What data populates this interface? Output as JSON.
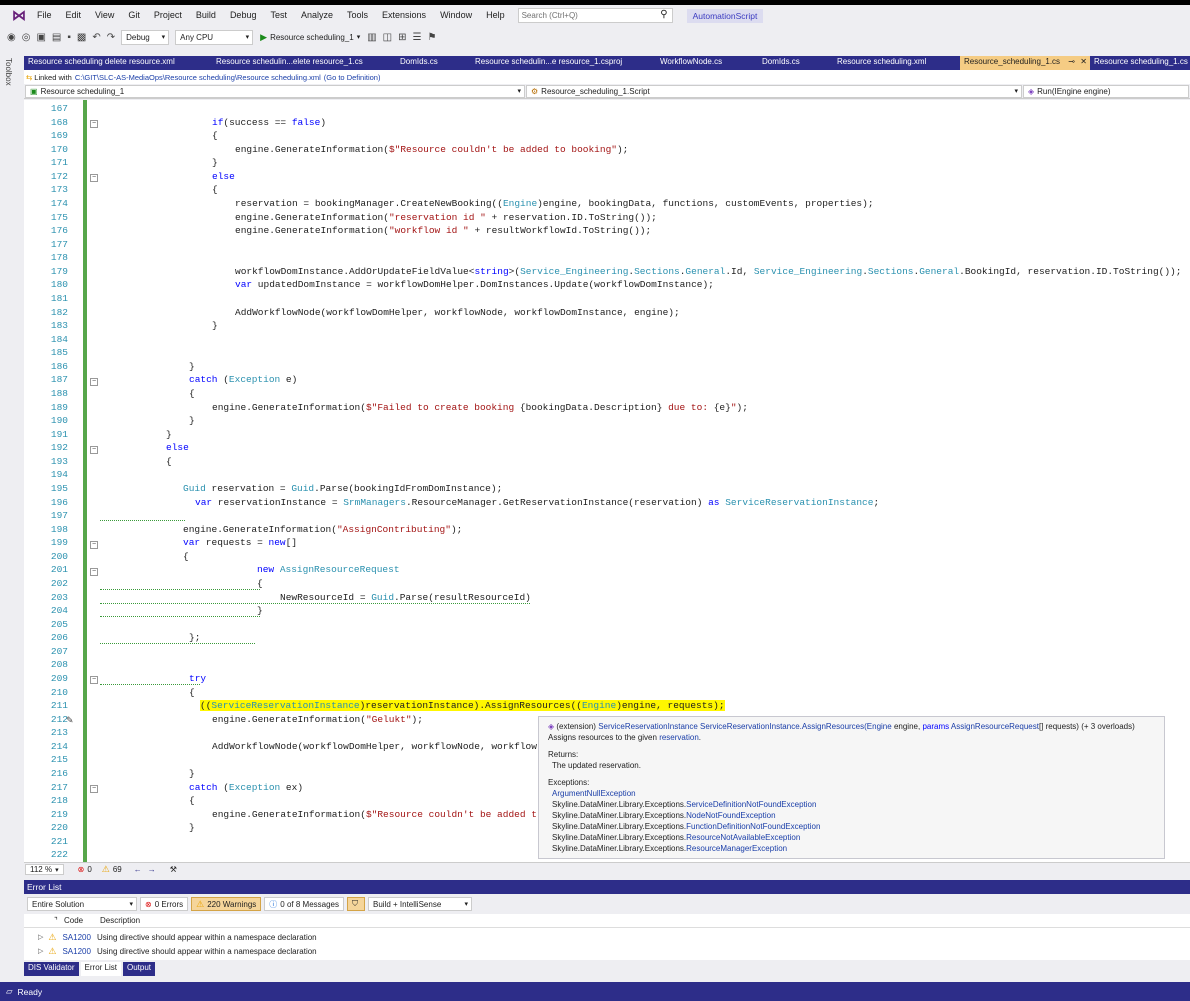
{
  "menu": [
    "File",
    "Edit",
    "View",
    "Git",
    "Project",
    "Build",
    "Debug",
    "Test",
    "Analyze",
    "Tools",
    "Extensions",
    "Window",
    "Help"
  ],
  "search": {
    "placeholder": "Search (Ctrl+Q)"
  },
  "automation_label": "AutomationScript",
  "toolbar": {
    "config": "Debug",
    "platform": "Any CPU",
    "run_target": "Resource scheduling_1"
  },
  "toolbox_label": "Toolbox",
  "tabs": [
    "Resource scheduling delete resource.xml",
    "Resource schedulin...elete resource_1.cs",
    "DomIds.cs",
    "Resource schedulin...e resource_1.csproj",
    "WorkflowNode.cs",
    "DomIds.cs",
    "Resource scheduling.xml",
    "Resource_scheduling_1.cs",
    "Resource scheduling_1.cs"
  ],
  "linked": {
    "prefix": "Linked with",
    "path": "C:\\GIT\\SLC-AS-MediaOps\\Resource scheduling\\Resource scheduling.xml",
    "goto": "(Go to Definition)"
  },
  "nav": {
    "project": "Resource scheduling_1",
    "class": "Resource_scheduling_1.Script",
    "member": "Run(IEngine engine)"
  },
  "line_numbers": [
    "167",
    "168",
    "169",
    "170",
    "171",
    "172",
    "173",
    "174",
    "175",
    "176",
    "177",
    "178",
    "179",
    "180",
    "181",
    "182",
    "183",
    "184",
    "185",
    "186",
    "187",
    "188",
    "189",
    "190",
    "191",
    "192",
    "193",
    "194",
    "195",
    "196",
    "197",
    "198",
    "199",
    "200",
    "201",
    "202",
    "203",
    "204",
    "205",
    "206",
    "207",
    "208",
    "209",
    "210",
    "211",
    "212",
    "213",
    "214",
    "215",
    "216",
    "217",
    "218",
    "219",
    "220",
    "221",
    "222"
  ],
  "code": {
    "l168": "if(success == false)",
    "l169": "{",
    "l170": "engine.GenerateInformation($\"Resource couldn't be added to booking\");",
    "l171": "}",
    "l172": "else",
    "l173": "{",
    "l174": "reservation = bookingManager.CreateNewBooking((Engine)engine, bookingData, functions, customEvents, properties);",
    "l175": "engine.GenerateInformation(\"reservation id \" + reservation.ID.ToString());",
    "l176": "engine.GenerateInformation(\"workflow id \" + resultWorkflowId.ToString());",
    "l179": "workflowDomInstance.AddOrUpdateFieldValue<string>(Service_Engineering.Sections.General.Id, Service_Engineering.Sections.General.BookingId, reservation.ID.ToString());",
    "l180": "var updatedDomInstance = workflowDomHelper.DomInstances.Update(workflowDomInstance);",
    "l182": "AddWorkflowNode(workflowDomHelper, workflowNode, workflowDomInstance, engine);",
    "l183": "}",
    "l186": "}",
    "l187": "catch (Exception e)",
    "l188": "{",
    "l189": "engine.GenerateInformation($\"Failed to create booking {bookingData.Description} due to: {e}\");",
    "l190": "}",
    "l191": "}",
    "l192": "else",
    "l193": "{",
    "l195": "Guid reservation = Guid.Parse(bookingIdFromDomInstance);",
    "l196": "var reservationInstance = SrmManagers.ResourceManager.GetReservationInstance(reservation) as ServiceReservationInstance;",
    "l198": "engine.GenerateInformation(\"AssignContributing\");",
    "l199": "var requests = new[]",
    "l200": "{",
    "l201": "new AssignResourceRequest",
    "l202": "{",
    "l203": "NewResourceId = Guid.Parse(resultResourceId)",
    "l204": "}",
    "l206": "};",
    "l209": "try",
    "l210": "{",
    "l211": "((ServiceReservationInstance)reservationInstance).AssignResources((Engine)engine, requests);",
    "l212": "engine.GenerateInformation(\"Gelukt\");",
    "l214": "AddWorkflowNode(workflowDomHelper, workflowNode, workflow",
    "l216": "}",
    "l217": "catch (Exception ex)",
    "l218": "{",
    "l219": "engine.GenerateInformation($\"Resource couldn't be added t",
    "l220": "}"
  },
  "tooltip": {
    "signature_prefix": "(extension)",
    "signature_type": "ServiceReservationInstance",
    "signature_method": "ServiceReservationInstance.AssignResources(",
    "signature_param1": "Engine",
    "signature_param1_name": "engine,",
    "signature_params_kw": "params",
    "signature_param2": "AssignResourceRequest",
    "signature_tail": "[] requests) (+ 3 overloads)",
    "summary_text": "Assigns resources to the given",
    "summary_link": "reservation",
    "summary_end": ".",
    "returns_label": "Returns:",
    "returns_text": "The updated reservation.",
    "exceptions_label": "Exceptions:",
    "exceptions": [
      {
        "prefix": "",
        "name": "ArgumentNullException"
      },
      {
        "prefix": "Skyline.DataMiner.Library.Exceptions.",
        "name": "ServiceDefinitionNotFoundException"
      },
      {
        "prefix": "Skyline.DataMiner.Library.Exceptions.",
        "name": "NodeNotFoundException"
      },
      {
        "prefix": "Skyline.DataMiner.Library.Exceptions.",
        "name": "FunctionDefinitionNotFoundException"
      },
      {
        "prefix": "Skyline.DataMiner.Library.Exceptions.",
        "name": "ResourceNotAvailableException"
      },
      {
        "prefix": "Skyline.DataMiner.Library.Exceptions.",
        "name": "ResourceManagerException"
      }
    ]
  },
  "editor_status": {
    "zoom": "112 %",
    "errors": "0",
    "warnings": "69"
  },
  "error_list": {
    "title": "Error List",
    "scope": "Entire Solution",
    "errors_btn": "0 Errors",
    "warnings_btn": "220 Warnings",
    "messages_btn": "0 of 8 Messages",
    "build_filter": "Build + IntelliSense",
    "col_code": "Code",
    "col_desc": "Description",
    "rows": [
      {
        "code": "SA1200",
        "desc": "Using directive should appear within a namespace declaration"
      },
      {
        "code": "SA1200",
        "desc": "Using directive should appear within a namespace declaration"
      }
    ]
  },
  "bottom_tabs": [
    "DIS Validator",
    "Error List",
    "Output"
  ],
  "status": "Ready"
}
